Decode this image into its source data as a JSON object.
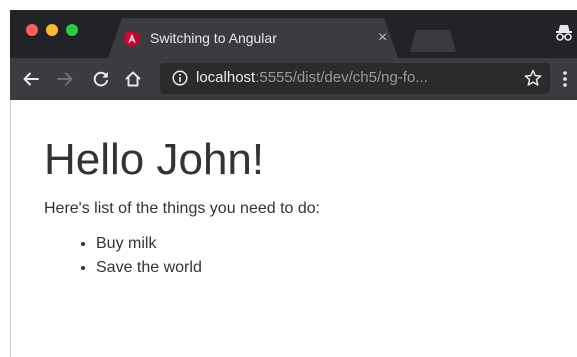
{
  "browser": {
    "tab": {
      "title": "Switching to Angular",
      "close_glyph": "×",
      "favicon": "angular-icon",
      "favicon_color": "#dd0031"
    },
    "toolbar": {
      "url_host": "localhost",
      "url_rest": ":5555/dist/dev/ch5/ng-fo...",
      "icons": [
        "back-arrow-icon",
        "forward-arrow-icon",
        "reload-icon",
        "home-icon",
        "info-icon",
        "bookmark-star-icon",
        "more-menu-icon"
      ]
    },
    "window_controls": {
      "close_color": "#fc5f57",
      "minimize_color": "#fdbc2e",
      "zoom_color": "#29c940"
    }
  },
  "page": {
    "heading": "Hello John!",
    "subtitle": "Here's list of the things you need to do:",
    "todos": [
      "Buy milk",
      "Save the world"
    ]
  }
}
